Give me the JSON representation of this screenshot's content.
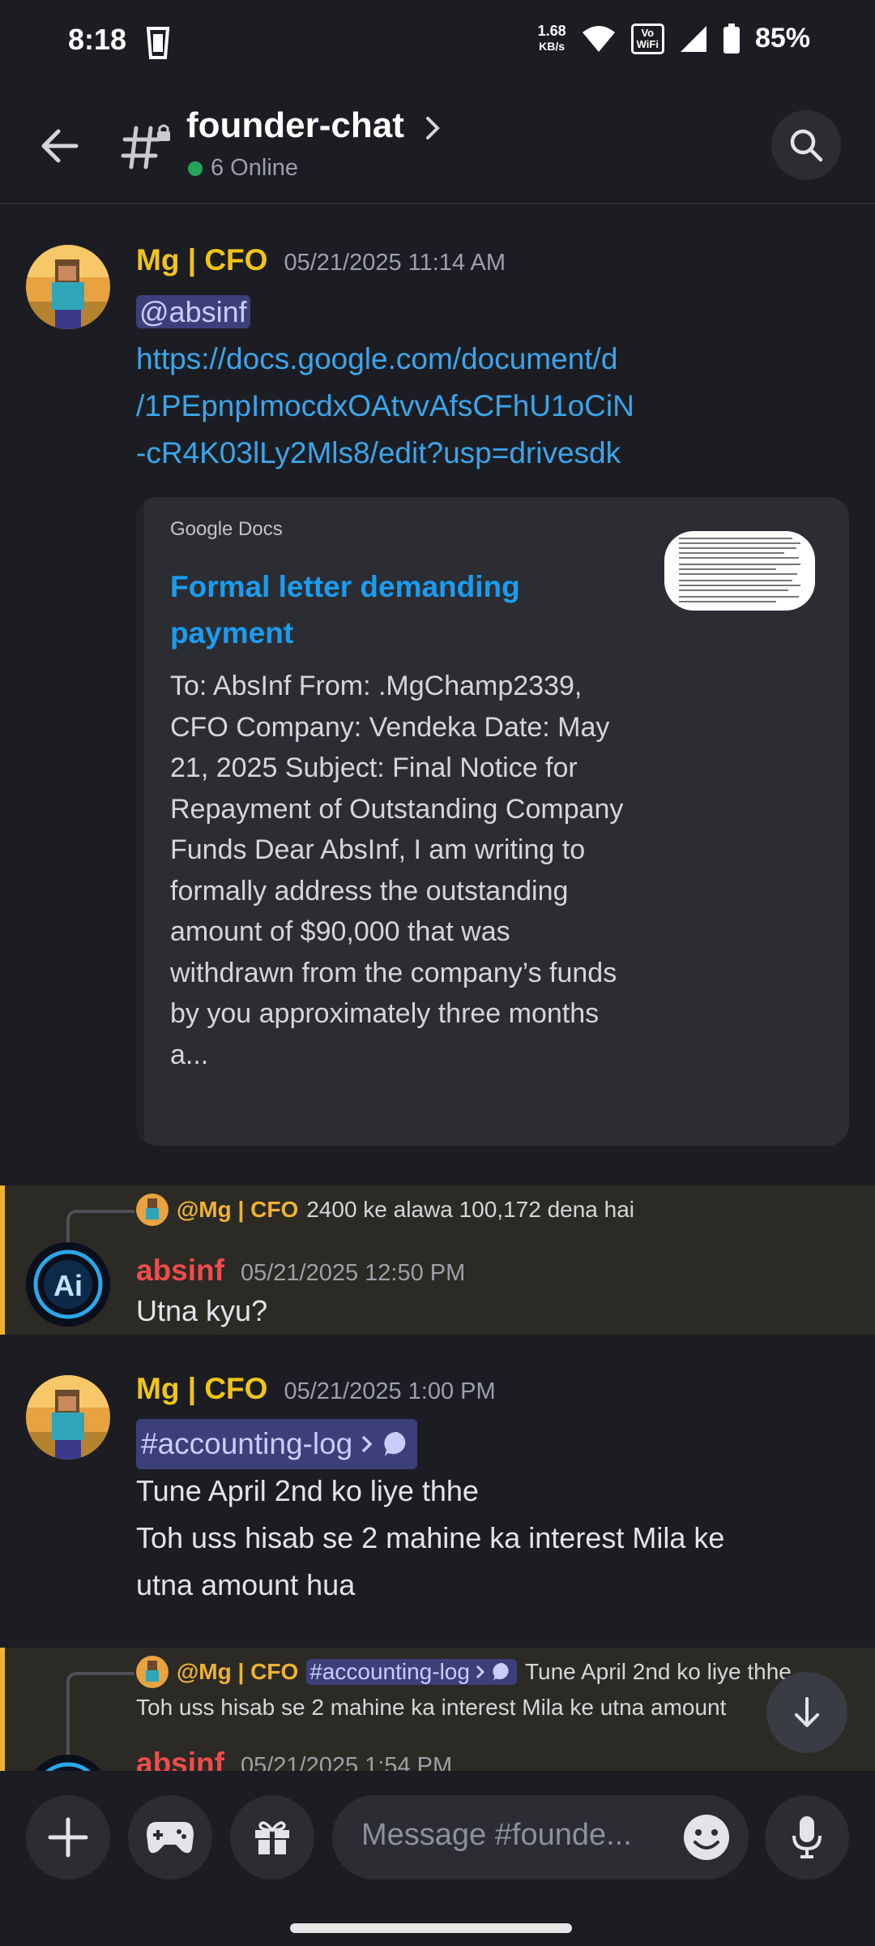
{
  "status_bar": {
    "time": "8:18",
    "net_speed_value": "1.68",
    "net_speed_unit": "KB/s",
    "vowifi_top": "Vo",
    "vowifi_bottom": "WiFi",
    "battery": "85%"
  },
  "header": {
    "channel_name": "founder-chat",
    "online": "6 Online"
  },
  "messages": [
    {
      "author": "Mg | CFO",
      "author_color": "#f0c419",
      "timestamp": "05/21/2025 11:14 AM",
      "mention": "@absinf",
      "link_lines": [
        "https://docs.google.com/document/d",
        "/1PEpnpImocdxOAtvvAfsCFhU1oCiN",
        "-cR4K03lLy2Mls8/edit?usp=drivesdk"
      ],
      "embed": {
        "provider": "Google Docs",
        "title": "Formal letter demanding payment",
        "description": "To: AbsInf From: .MgChamp2339, CFO Company: Vendeka Date: May 21, 2025  Subject: Final Notice for Repayment of Outstanding Company Funds  Dear AbsInf, I am writing to formally address the outstanding amount of $90,000 that was withdrawn from the company’s funds by you approximately three months a..."
      }
    },
    {
      "reply_to_name": "@Mg | CFO",
      "reply_to_text": "2400 ke alawa 100,172 dena hai",
      "author": "absinf",
      "author_color": "#f04c4c",
      "timestamp": "05/21/2025 12:50 PM",
      "text": "Utna kyu?"
    },
    {
      "author": "Mg | CFO",
      "author_color": "#f0c419",
      "timestamp": "05/21/2025 1:00 PM",
      "channel_mention": "#accounting-log",
      "lines": [
        "Tune April 2nd ko liye thhe",
        "Toh uss hisab se 2 mahine ka interest Mila ke",
        "utna amount hua"
      ]
    },
    {
      "reply_to_name": "@Mg | CFO",
      "reply_to_channel": "#accounting-log",
      "reply_to_text": "Tune April 2nd ko liye thhe",
      "reply_to_text_line2": "Toh uss hisab se 2 mahine ka interest Mila ke utna amount",
      "author": "absinf",
      "author_color": "#f04c4c",
      "timestamp": "05/21/2025 1:54 PM"
    }
  ],
  "composer": {
    "placeholder": "Message #founde..."
  },
  "icons": {
    "back": "back-arrow-icon",
    "channel": "locked-hash-icon",
    "search": "search-icon",
    "plus": "plus-icon",
    "games": "gamepad-icon",
    "gift": "gift-icon",
    "emoji": "emoji-icon",
    "mic": "microphone-icon",
    "scroll": "arrow-down-icon"
  }
}
